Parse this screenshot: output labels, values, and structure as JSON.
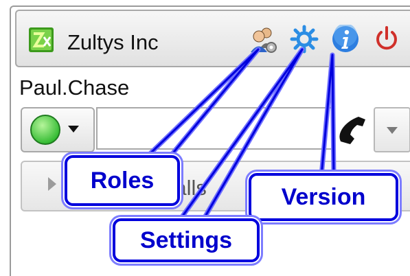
{
  "titlebar": {
    "company": "Zultys Inc",
    "icons": {
      "logo": "zultys-logo-icon",
      "roles": "roles-users-icon",
      "settings": "gear-icon",
      "version": "info-icon",
      "power": "power-icon"
    }
  },
  "user": {
    "name": "Paul.Chase"
  },
  "dialer": {
    "input_value": "",
    "status_color": "#2fb92f",
    "icons": {
      "status": "presence-status-icon",
      "dropdown": "chevron-down-icon",
      "call": "handset-icon",
      "menu": "chevron-down-icon"
    }
  },
  "calls": {
    "label": "Calls",
    "icon": "chevron-right-icon"
  },
  "callouts": {
    "roles": "Roles",
    "settings": "Settings",
    "version": "Version",
    "accent": "#0000dd"
  }
}
